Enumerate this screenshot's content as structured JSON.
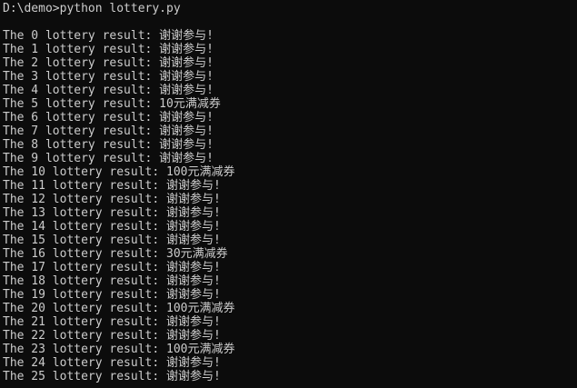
{
  "console": {
    "command_line": "D:\\demo>python lottery.py",
    "output_lines": [
      "The 0 lottery result: 谢谢参与!",
      "The 1 lottery result: 谢谢参与!",
      "The 2 lottery result: 谢谢参与!",
      "The 3 lottery result: 谢谢参与!",
      "The 4 lottery result: 谢谢参与!",
      "The 5 lottery result: 10元满减券",
      "The 6 lottery result: 谢谢参与!",
      "The 7 lottery result: 谢谢参与!",
      "The 8 lottery result: 谢谢参与!",
      "The 9 lottery result: 谢谢参与!",
      "The 10 lottery result: 100元满减券",
      "The 11 lottery result: 谢谢参与!",
      "The 12 lottery result: 谢谢参与!",
      "The 13 lottery result: 谢谢参与!",
      "The 14 lottery result: 谢谢参与!",
      "The 15 lottery result: 谢谢参与!",
      "The 16 lottery result: 30元满减券",
      "The 17 lottery result: 谢谢参与!",
      "The 18 lottery result: 谢谢参与!",
      "The 19 lottery result: 谢谢参与!",
      "The 20 lottery result: 100元满减券",
      "The 21 lottery result: 谢谢参与!",
      "The 22 lottery result: 谢谢参与!",
      "The 23 lottery result: 100元满减券",
      "The 24 lottery result: 谢谢参与!",
      "The 25 lottery result: 谢谢参与!"
    ]
  },
  "colors": {
    "background": "#0c0c0c",
    "text": "#cccccc"
  }
}
